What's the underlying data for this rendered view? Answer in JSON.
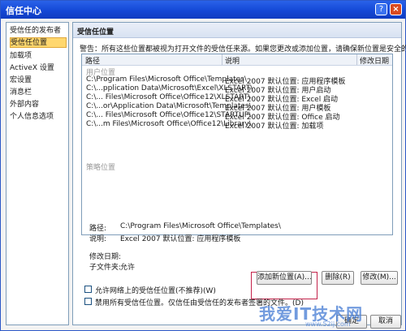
{
  "window": {
    "title": "信任中心",
    "help_icon": "?",
    "close_icon": "×"
  },
  "sidebar": {
    "items": [
      {
        "label": "受信任的发布者"
      },
      {
        "label": "受信任位置",
        "selected": true
      },
      {
        "label": "加载项"
      },
      {
        "label": "ActiveX 设置"
      },
      {
        "label": "宏设置"
      },
      {
        "label": "消息栏"
      },
      {
        "label": "外部内容"
      },
      {
        "label": "个人信息选项"
      }
    ]
  },
  "panel": {
    "title": "受信任位置",
    "warning": "警告：所有这些位置都被视为打开文件的受信任来源。如果您更改或添加位置，请确保新位置是安全的。"
  },
  "table": {
    "headers": {
      "path": "路径",
      "description": "说明",
      "modified": "修改日期"
    },
    "user_group": "用户位置",
    "policy_group": "策略位置",
    "rows": [
      {
        "path": "C:\\Program Files\\Microsoft Office\\Templates\\",
        "description": "Excel 2007 默认位置: 应用程序模板"
      },
      {
        "path": "C:\\...pplication Data\\Microsoft\\Excel\\XLSTART\\",
        "description": "Excel 2007 默认位置: 用户启动"
      },
      {
        "path": "C:\\... Files\\Microsoft Office\\Office12\\XLSTART\\",
        "description": "Excel 2007 默认位置: Excel 启动"
      },
      {
        "path": "C:\\...or\\Application Data\\Microsoft\\Templates\\",
        "description": "Excel 2007 默认位置: 用户模板"
      },
      {
        "path": "C:\\... Files\\Microsoft Office\\Office12\\STARTUP\\",
        "description": "Excel 2007 默认位置: Office 启动"
      },
      {
        "path": "C:\\...m Files\\Microsoft Office\\Office12\\Library\\",
        "description": "Excel 2007 默认位置: 加载项"
      }
    ]
  },
  "details": {
    "path_label": "路径:",
    "path_value": "C:\\Program Files\\Microsoft Office\\Templates\\",
    "desc_label": "说明:",
    "desc_value": "Excel 2007 默认位置: 应用程序模板",
    "modified_label": "修改日期:",
    "subfolders_label": "子文件夹:",
    "subfolders_value": "允许"
  },
  "buttons": {
    "add": "添加新位置(A)...",
    "remove": "删除(R)",
    "modify": "修改(M)...",
    "ok": "确定",
    "cancel": "取消"
  },
  "options": {
    "allow_network": "允许网络上的受信任位置(不推荐)(W)",
    "disable_all": "禁用所有受信任位置。仅信任由受信任的发布者签署的文件。(D)"
  },
  "watermark": {
    "text": "我爱IT技术网",
    "url": "www.52ij.com"
  }
}
